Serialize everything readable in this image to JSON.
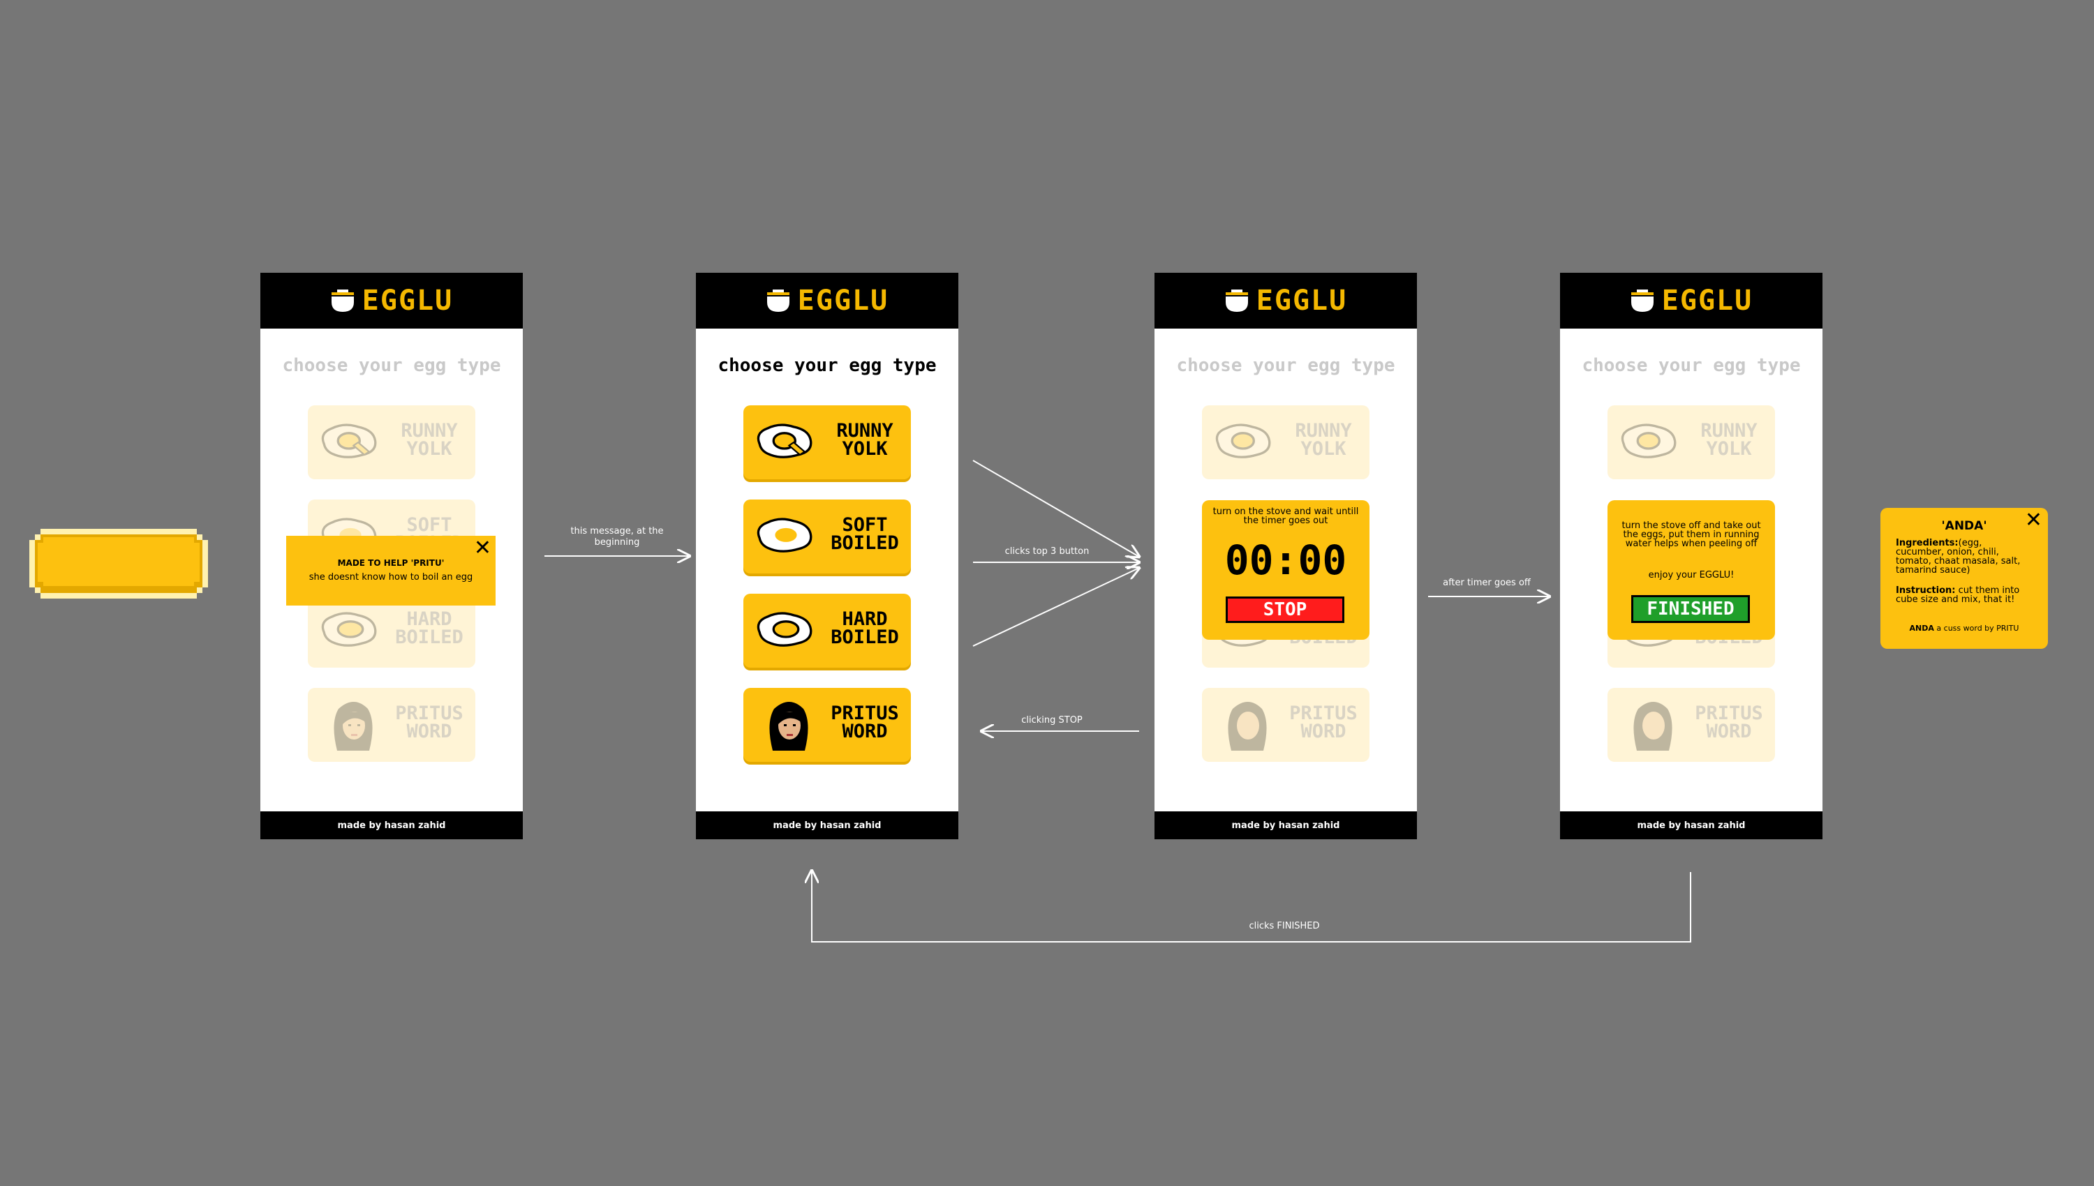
{
  "app": {
    "name": "EGGLU",
    "screen_title": "choose your egg type",
    "footer": "made by hasan zahid"
  },
  "egg_options": [
    {
      "id": "runny",
      "label": "RUNNY\nYOLK"
    },
    {
      "id": "soft",
      "label": "SOFT\nBOILED"
    },
    {
      "id": "hard",
      "label": "HARD\nBOILED"
    },
    {
      "id": "pritu",
      "label": "PRITUS\nWORD"
    }
  ],
  "intro_toast": {
    "line1": "MADE TO HELP 'PRITU'",
    "line2": "she doesnt know how to boil an egg",
    "close": "✕"
  },
  "timer_modal": {
    "message": "turn on the stove and wait untill the timer goes out",
    "time": "00:00",
    "stop_label": "STOP"
  },
  "finished_modal": {
    "message": "turn the stove off and take out the eggs, put them in running water helps when peeling off",
    "enjoy": "enjoy your EGGLU!",
    "finished_label": "FINISHED"
  },
  "anda_card": {
    "title": "'ANDA'",
    "close": "✕",
    "ingredients_label": "Ingredients:",
    "ingredients": "(egg, cucumber, onion, chili, tomato, chaat masala, salt, tamarind sauce)",
    "instruction_label": "Instruction:",
    "instruction": " cut them into cube size and mix, that it!",
    "footer_strong": "ANDA",
    "footer_rest": " a cuss word by PRITU"
  },
  "flow_labels": {
    "intro": "this message, at the beginning",
    "top3": "clicks top 3 button",
    "stop": "clicking STOP",
    "timer_off": "after timer goes off",
    "finished": "clicks FINISHED"
  },
  "colors": {
    "background": "#767676",
    "accent": "#fdc10f",
    "accent_dark": "#e3a800",
    "stop_red": "#ff1c1c",
    "finished_green": "#1f9f2a",
    "black": "#000000"
  },
  "icons": [
    "egg-cup-icon",
    "fried-egg-runny-icon",
    "fried-egg-soft-icon",
    "fried-egg-hard-icon",
    "pritu-avatar-icon",
    "close-icon",
    "arrow-icon"
  ]
}
